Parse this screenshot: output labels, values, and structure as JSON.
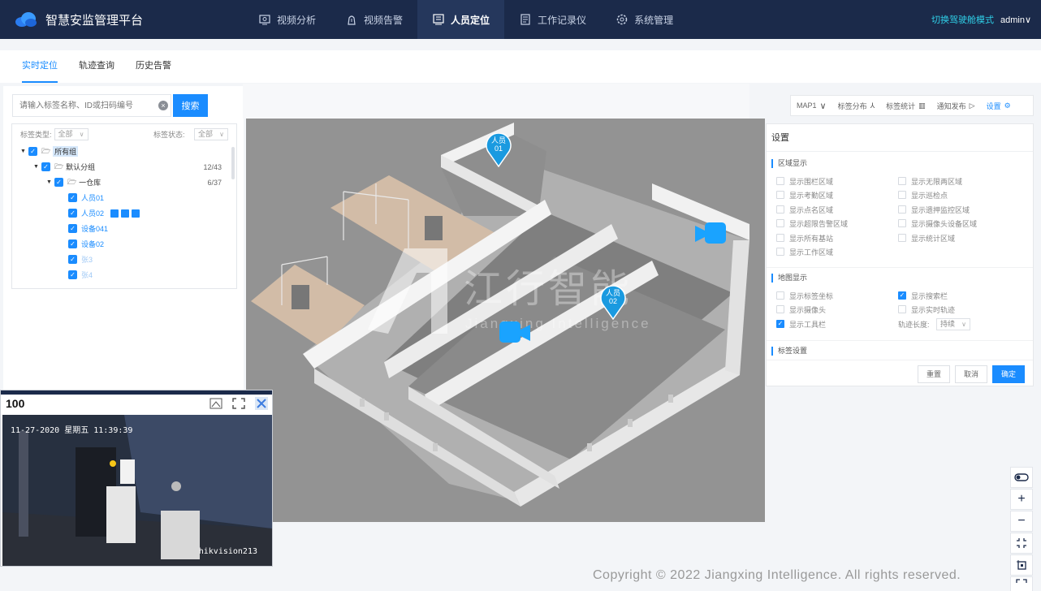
{
  "app": {
    "title": "智慧安监管理平台"
  },
  "nav": [
    {
      "label": "视频分析",
      "icon": "video-analysis-icon"
    },
    {
      "label": "视频告警",
      "icon": "alarm-icon"
    },
    {
      "label": "人员定位",
      "icon": "location-icon",
      "active": true
    },
    {
      "label": "工作记录仪",
      "icon": "recorder-icon"
    },
    {
      "label": "系统管理",
      "icon": "gear-icon"
    }
  ],
  "header_right": {
    "mode": "切换驾驶舱模式",
    "user": "admin∨"
  },
  "subtabs": [
    "实时定位",
    "轨迹查询",
    "历史告警"
  ],
  "search": {
    "placeholder": "请输入标签名称、ID或扫码编号",
    "button": "搜索"
  },
  "filters": {
    "type_label": "标签类型:",
    "type_value": "全部",
    "status_label": "标签状态:",
    "status_value": "全部"
  },
  "tree": {
    "root": "所有组",
    "group": "默认分组",
    "group_count": "12/43",
    "warehouse": "一仓库",
    "warehouse_count": "6/37",
    "leaves": [
      "人员01",
      "人员02",
      "设备041",
      "设备02",
      "张3",
      "张4"
    ]
  },
  "toolbar": {
    "map": "MAP1",
    "dist": "标签分布",
    "stats": "标签统计",
    "notify": "通知发布",
    "settings": "设置"
  },
  "settings": {
    "title": "设置",
    "area_section": "区域显示",
    "area_left": [
      "显示围栏区域",
      "显示考勤区域",
      "显示点名区域",
      "显示超限告警区域",
      "显示所有基站",
      "显示工作区域"
    ],
    "area_right": [
      "显示无限两区域",
      "显示巡检点",
      "显示遗押监控区域",
      "显示摄像头设备区域",
      "显示统计区域"
    ],
    "map_section": "地图显示",
    "map_left": [
      "显示标签坐标",
      "显示摄像头",
      "显示工具栏"
    ],
    "map_right": [
      "显示搜索栏",
      "显示实时轨迹"
    ],
    "trail_label": "轨迹长度:",
    "trail_value": "持续",
    "tag_section": "标签设置",
    "btn_reset": "重置",
    "btn_cancel": "取消",
    "btn_ok": "确定"
  },
  "markers": [
    {
      "line1": "人员",
      "line2": "01"
    },
    {
      "line1": "人员",
      "line2": "02"
    }
  ],
  "watermark": {
    "cn": "江行智能",
    "en": "Jiangxing Intelligence"
  },
  "video": {
    "channel": "100",
    "osd_time": "11-27-2020 星期五 11:39:39",
    "osd_cam": "hikvision213"
  },
  "copyright": "Copyright © 2022 Jiangxing Intelligence. All rights reserved.",
  "colors": {
    "header": "#1b2a4a",
    "accent": "#1a8cff",
    "mode": "#2fd0e8"
  }
}
